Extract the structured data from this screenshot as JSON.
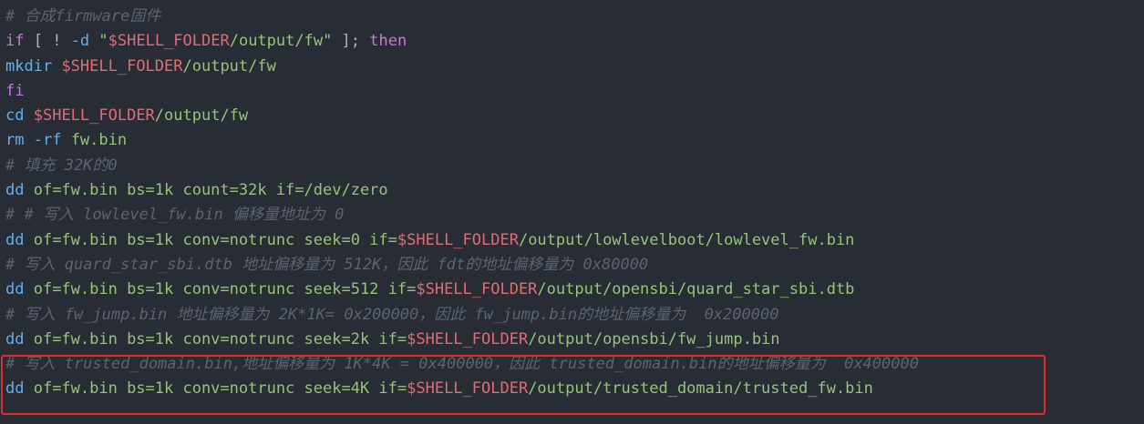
{
  "colors": {
    "background": "#282c34",
    "comment": "#5c6370",
    "keyword": "#c678dd",
    "command": "#61afef",
    "variable": "#e06c75",
    "string": "#98c379",
    "highlight_border": "#e32b2b"
  },
  "lines": [
    [
      {
        "t": "# 合成firmware固件",
        "c": "comment"
      }
    ],
    [
      {
        "t": "if",
        "c": "kw"
      },
      {
        "t": " [ ! ",
        "c": "plain"
      },
      {
        "t": "-d",
        "c": "cmd"
      },
      {
        "t": " ",
        "c": "plain"
      },
      {
        "t": "\"",
        "c": "str"
      },
      {
        "t": "$SHELL_FOLDER",
        "c": "var"
      },
      {
        "t": "/output/fw\"",
        "c": "str"
      },
      {
        "t": " ]; ",
        "c": "plain"
      },
      {
        "t": "then",
        "c": "kw"
      }
    ],
    [
      {
        "t": "mkdir",
        "c": "cmd"
      },
      {
        "t": " ",
        "c": "plain"
      },
      {
        "t": "$SHELL_FOLDER",
        "c": "var"
      },
      {
        "t": "/output/fw",
        "c": "str"
      }
    ],
    [
      {
        "t": "fi",
        "c": "kw"
      }
    ],
    [
      {
        "t": "cd",
        "c": "cmd"
      },
      {
        "t": " ",
        "c": "plain"
      },
      {
        "t": "$SHELL_FOLDER",
        "c": "var"
      },
      {
        "t": "/output/fw",
        "c": "str"
      }
    ],
    [
      {
        "t": "rm",
        "c": "cmd"
      },
      {
        "t": " ",
        "c": "plain"
      },
      {
        "t": "-rf",
        "c": "cmd"
      },
      {
        "t": " fw.bin",
        "c": "str"
      }
    ],
    [
      {
        "t": "# 填充 32K的0",
        "c": "comment"
      }
    ],
    [
      {
        "t": "dd",
        "c": "cmd"
      },
      {
        "t": " of=fw.bin bs=1k count=32k if=/dev/zero",
        "c": "str"
      }
    ],
    [
      {
        "t": "# # 写入 lowlevel_fw.bin 偏移量地址为 0",
        "c": "comment"
      }
    ],
    [
      {
        "t": "dd",
        "c": "cmd"
      },
      {
        "t": " of=fw.bin bs=1k conv=notrunc seek=0 if=",
        "c": "str"
      },
      {
        "t": "$SHELL_FOLDER",
        "c": "var"
      },
      {
        "t": "/output/lowlevelboot/lowlevel_fw.bin",
        "c": "str"
      }
    ],
    [
      {
        "t": "# 写入 quard_star_sbi.dtb 地址偏移量为 512K，因此 fdt的地址偏移量为 0x80000",
        "c": "comment"
      }
    ],
    [
      {
        "t": "dd",
        "c": "cmd"
      },
      {
        "t": " of=fw.bin bs=1k conv=notrunc seek=512 if=",
        "c": "str"
      },
      {
        "t": "$SHELL_FOLDER",
        "c": "var"
      },
      {
        "t": "/output/opensbi/quard_star_sbi.dtb",
        "c": "str"
      }
    ],
    [
      {
        "t": "# 写入 fw_jump.bin 地址偏移量为 2K*1K= 0x200000，因此 fw_jump.bin的地址偏移量为  0x200000",
        "c": "comment"
      }
    ],
    [
      {
        "t": "dd",
        "c": "cmd"
      },
      {
        "t": " of=fw.bin bs=1k conv=notrunc seek=2k if=",
        "c": "str"
      },
      {
        "t": "$SHELL_FOLDER",
        "c": "var"
      },
      {
        "t": "/output/opensbi/fw_jump.bin",
        "c": "str"
      }
    ],
    [
      {
        "t": "# 写入 trusted_domain.bin,地址偏移量为 1K*4K = 0x400000，因此 trusted_domain.bin的地址偏移量为  0x400000",
        "c": "comment"
      }
    ],
    [
      {
        "t": "dd",
        "c": "cmd"
      },
      {
        "t": " of=fw.bin bs=1k conv=notrunc seek=4K if=",
        "c": "str"
      },
      {
        "t": "$SHELL_FOLDER",
        "c": "var"
      },
      {
        "t": "/output/trusted_domain/trusted_fw.bin",
        "c": "str"
      }
    ]
  ]
}
